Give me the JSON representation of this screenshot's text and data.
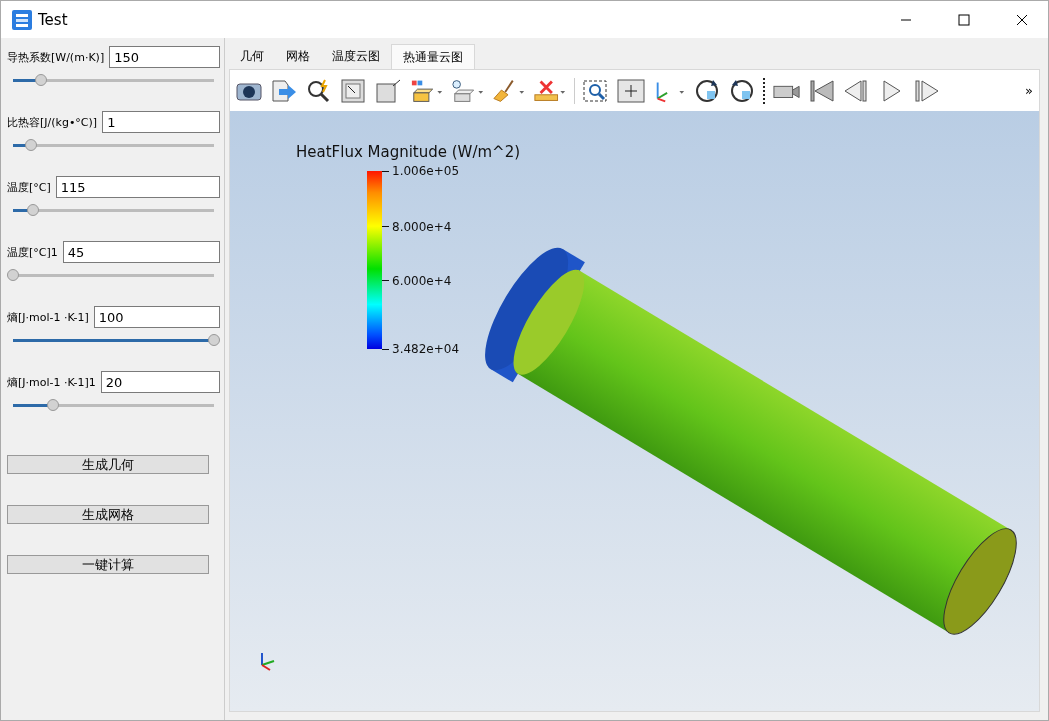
{
  "window": {
    "title": "Test"
  },
  "parameters": [
    {
      "label": "导热系数[W/(m·K)]",
      "value": "150",
      "level": 0.14
    },
    {
      "label": "比热容[J/(kg•°C)]",
      "value": "1",
      "level": 0.09
    },
    {
      "label": "温度[°C]",
      "value": "115",
      "level": 0.1
    },
    {
      "label": "温度[°C]1",
      "value": "45",
      "level": 0.0
    },
    {
      "label": "熵[J·mol-1 ·K-1]",
      "value": "100",
      "level": 1.0
    },
    {
      "label": "熵[J·mol-1 ·K-1]1",
      "value": "20",
      "level": 0.2
    }
  ],
  "buttons": [
    "生成几何",
    "生成网格",
    "一键计算"
  ],
  "tabs": [
    {
      "label": "几何",
      "selected": false
    },
    {
      "label": "网格",
      "selected": false
    },
    {
      "label": "温度云图",
      "selected": false
    },
    {
      "label": "热通量云图",
      "selected": true
    }
  ],
  "toolbar": {
    "overflow": "»"
  },
  "viewport": {
    "legend": {
      "title": "HeatFlux Magnitude (W/m^2)",
      "ticks": [
        "1.006e+05",
        "8.000e+4",
        "6.000e+4",
        "3.482e+04"
      ]
    }
  }
}
